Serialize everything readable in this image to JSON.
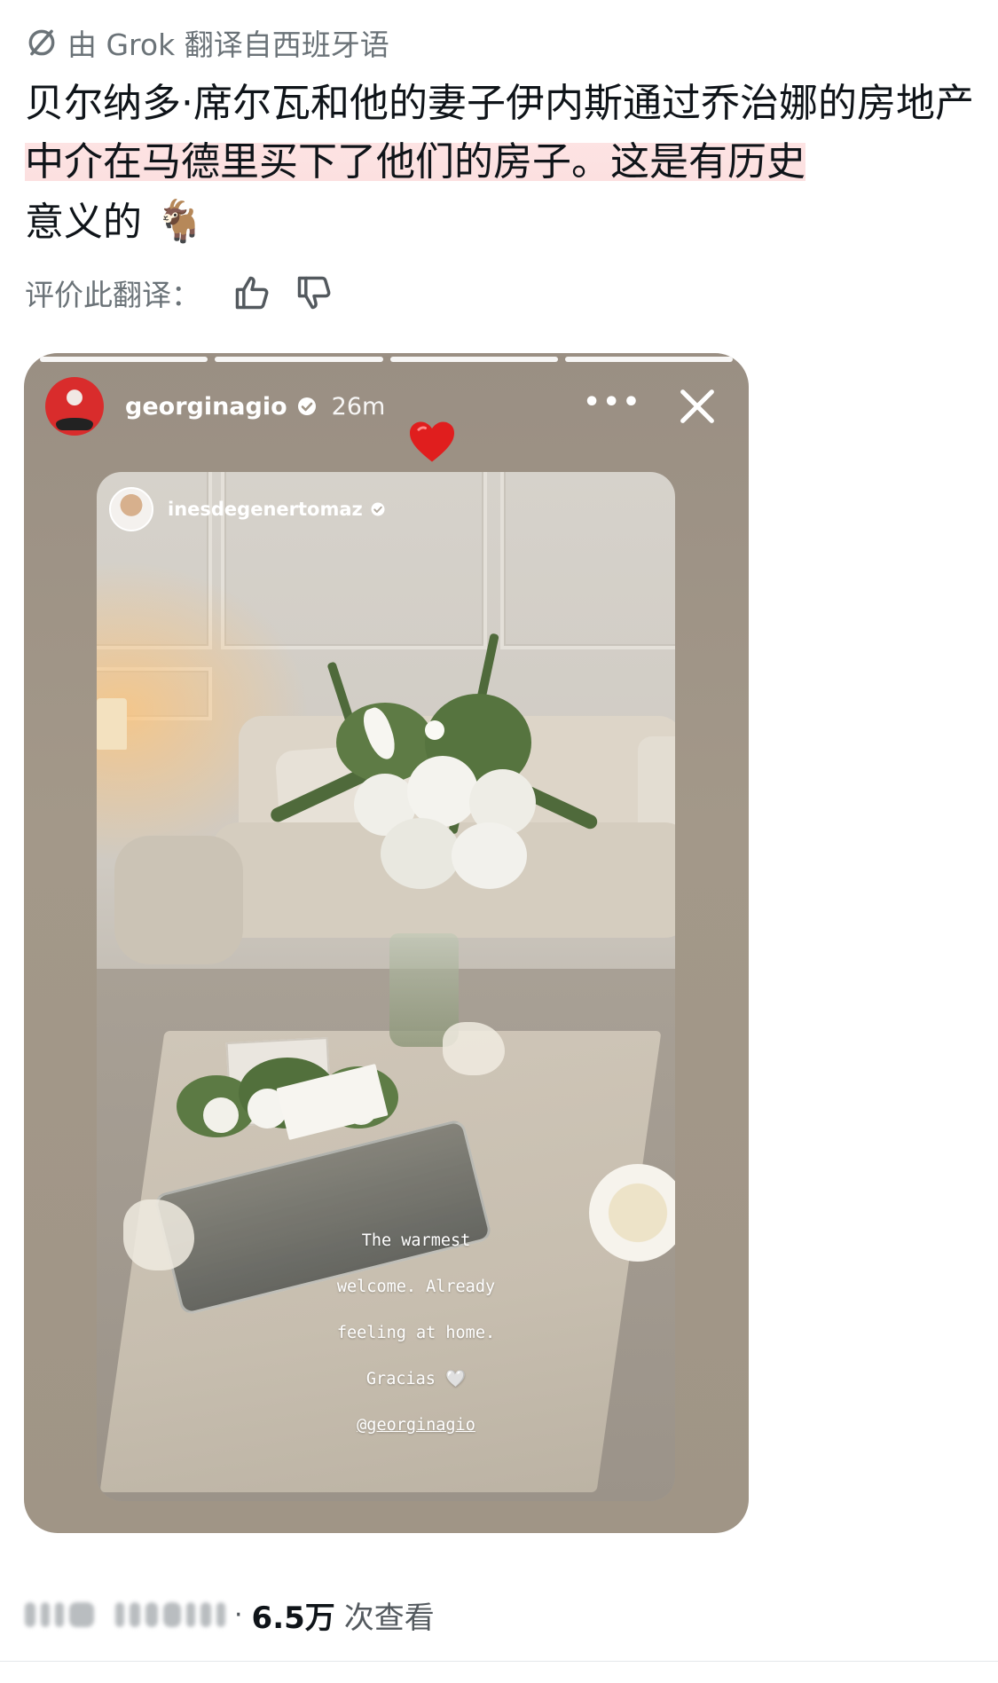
{
  "translation": {
    "label": "由 Grok 翻译自西班牙语",
    "icon": "grok-icon"
  },
  "tweet": {
    "text_part1": "贝尔纳多·席尔瓦和他的妻子伊内斯通过乔治娜的房地产",
    "text_highlight": "中介在马德里买下了他们的房子。这是有历史",
    "text_part2": "意义的",
    "emoji": "🐐",
    "highlight_color": "#fde3e3"
  },
  "rate": {
    "label": "评价此翻译：",
    "thumbs_up_icon": "thumbs-up-icon",
    "thumbs_down_icon": "thumbs-down-icon"
  },
  "story": {
    "username": "georginagio",
    "time": "26m",
    "more_label": "•••",
    "progress_segments": 4,
    "progress_done": 4,
    "reaction_icon": "heart-icon",
    "repost": {
      "username": "inesdegenertomaz",
      "caption_line1": "The warmest",
      "caption_line2": "welcome. Already",
      "caption_line3": "feeling at home.",
      "caption_line4": "Gracias 🤍",
      "caption_mention": "@georginagio"
    }
  },
  "footer": {
    "views_number": "6.5万",
    "views_label": "次查看",
    "separator": "·"
  },
  "colors": {
    "text": "#0f1419",
    "muted": "#6b7378",
    "story_bg": "#9e9385"
  }
}
